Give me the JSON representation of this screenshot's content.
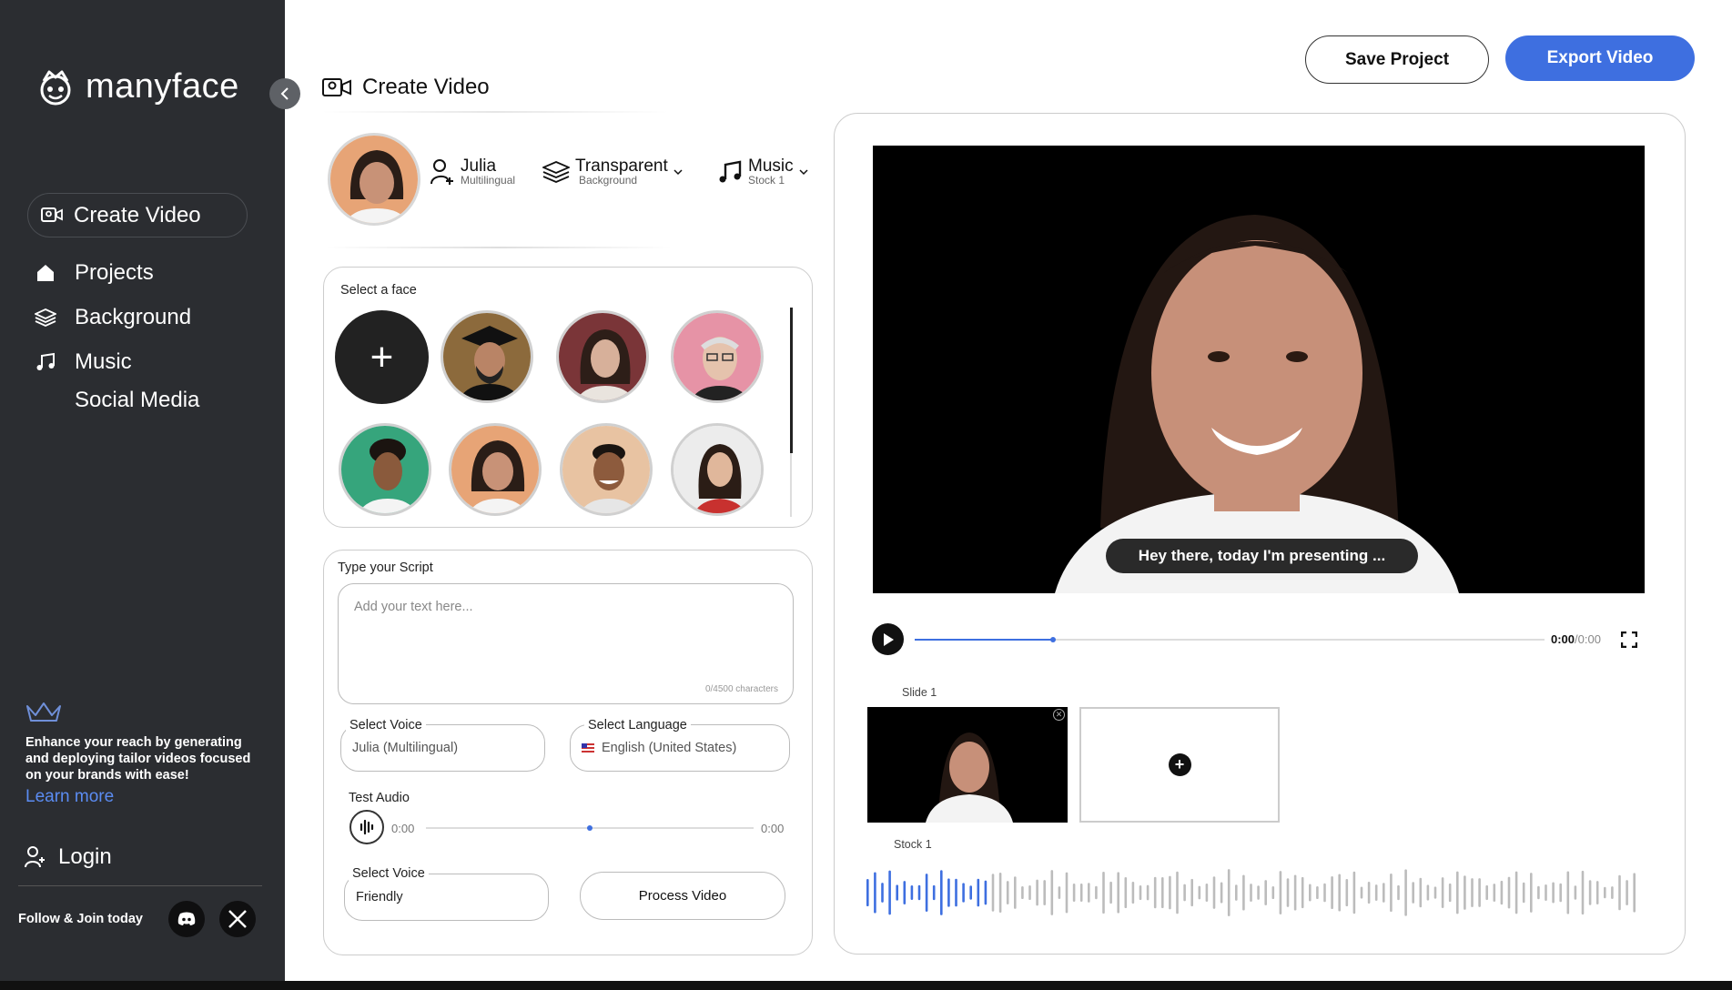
{
  "app": {
    "name": "manyface"
  },
  "sidebar": {
    "create": "Create Video",
    "items": [
      {
        "label": "Projects",
        "icon": "home-icon"
      },
      {
        "label": "Background",
        "icon": "layers-icon"
      },
      {
        "label": "Music",
        "icon": "music-icon"
      },
      {
        "label": "Social Media"
      }
    ],
    "promo_text": "Enhance your reach by generating and deploying tailor videos focused on your brands with ease!",
    "learn_more": "Learn more",
    "login": "Login",
    "follow": "Follow & Join today"
  },
  "header": {
    "title": "Create Video",
    "save": "Save Project",
    "export": "Export Video"
  },
  "options": {
    "avatar": {
      "main": "Julia",
      "sub": "Multilingual"
    },
    "background": {
      "main": "Transparent",
      "sub": "Background"
    },
    "music": {
      "main": "Music",
      "sub": "Stock 1"
    }
  },
  "faces": {
    "label": "Select a face"
  },
  "script": {
    "label": "Type your Script",
    "placeholder": "Add your text here...",
    "counter": "0/4500 characters",
    "voice_label": "Select Voice",
    "voice_value": "Julia (Multilingual)",
    "language_label": "Select Language",
    "language_value": "English (United States)",
    "test_audio": "Test Audio",
    "audio_start": "0:00",
    "audio_end": "0:00",
    "audio_progress": 0.5,
    "tone_label": "Select Voice",
    "tone_value": "Friendly",
    "process": "Process Video"
  },
  "preview": {
    "caption": "Hey there, today I'm presenting ...",
    "time_current": "0:00",
    "time_total": "/0:00",
    "progress": 0.22,
    "slide_label": "Slide 1",
    "music_label": "Stock 1"
  },
  "colors": {
    "accent": "#3e6fe0",
    "sidebar": "#2b2d31"
  }
}
